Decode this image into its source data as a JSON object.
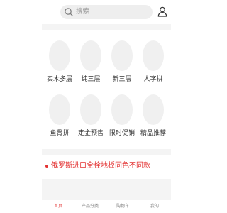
{
  "search": {
    "placeholder": "搜索",
    "icon": "search-icon"
  },
  "header": {
    "user_icon": "user-icon"
  },
  "categories": [
    {
      "label": "实木多层"
    },
    {
      "label": "纯三层"
    },
    {
      "label": "新三层"
    },
    {
      "label": "人字拼"
    },
    {
      "label": "鱼骨拼"
    },
    {
      "label": "定金预售"
    },
    {
      "label": "限时促销"
    },
    {
      "label": "精品推荐"
    }
  ],
  "notice": {
    "text": "俄罗斯进口全栓地板同色不同款"
  },
  "tabbar": {
    "active_index": 0,
    "items": [
      {
        "label": "首页"
      },
      {
        "label": "产品分类"
      },
      {
        "label": "购物车"
      },
      {
        "label": "我的"
      }
    ]
  },
  "colors": {
    "accent": "#e33333",
    "background": "#f4f4f4",
    "placeholder_circle": "#f0f0f0"
  }
}
